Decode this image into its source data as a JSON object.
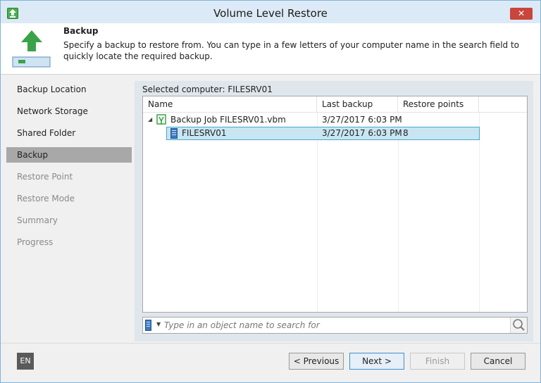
{
  "window": {
    "title": "Volume Level Restore",
    "close_symbol": "✕"
  },
  "header": {
    "title": "Backup",
    "description": "Specify a backup to restore from. You can type in a few letters of your computer name in the search field to quickly locate the required backup.",
    "icon": "upload-arrow-icon"
  },
  "sidebar": {
    "items": [
      {
        "label": "Backup Location",
        "state": "done"
      },
      {
        "label": "Network Storage",
        "state": "done"
      },
      {
        "label": "Shared Folder",
        "state": "done"
      },
      {
        "label": "Backup",
        "state": "active"
      },
      {
        "label": "Restore Point",
        "state": "disabled"
      },
      {
        "label": "Restore Mode",
        "state": "disabled"
      },
      {
        "label": "Summary",
        "state": "disabled"
      },
      {
        "label": "Progress",
        "state": "disabled"
      }
    ]
  },
  "main": {
    "selected_computer_label": "Selected computer: FILESRV01",
    "columns": [
      "Name",
      "Last backup",
      "Restore points"
    ],
    "rows": [
      {
        "name": "Backup Job FILESRV01.vbm",
        "last_backup": "3/27/2017 6:03 PM",
        "restore_points": "",
        "level": 0,
        "expanded": true,
        "icon": "backup-job-icon"
      },
      {
        "name": "FILESRV01",
        "last_backup": "3/27/2017 6:03 PM",
        "restore_points": "8",
        "level": 1,
        "selected": true,
        "icon": "server-icon"
      }
    ],
    "search": {
      "placeholder": "Type in an object name to search for",
      "value": ""
    }
  },
  "footer": {
    "language": "EN",
    "previous_label": "< Previous",
    "next_label": "Next >",
    "finish_label": "Finish",
    "cancel_label": "Cancel"
  },
  "colors": {
    "accent": "#4caf50",
    "selection": "#c8e6f2",
    "selection_border": "#4aa6d0",
    "close": "#c9463d",
    "nav_active": "#a8a8a8"
  }
}
